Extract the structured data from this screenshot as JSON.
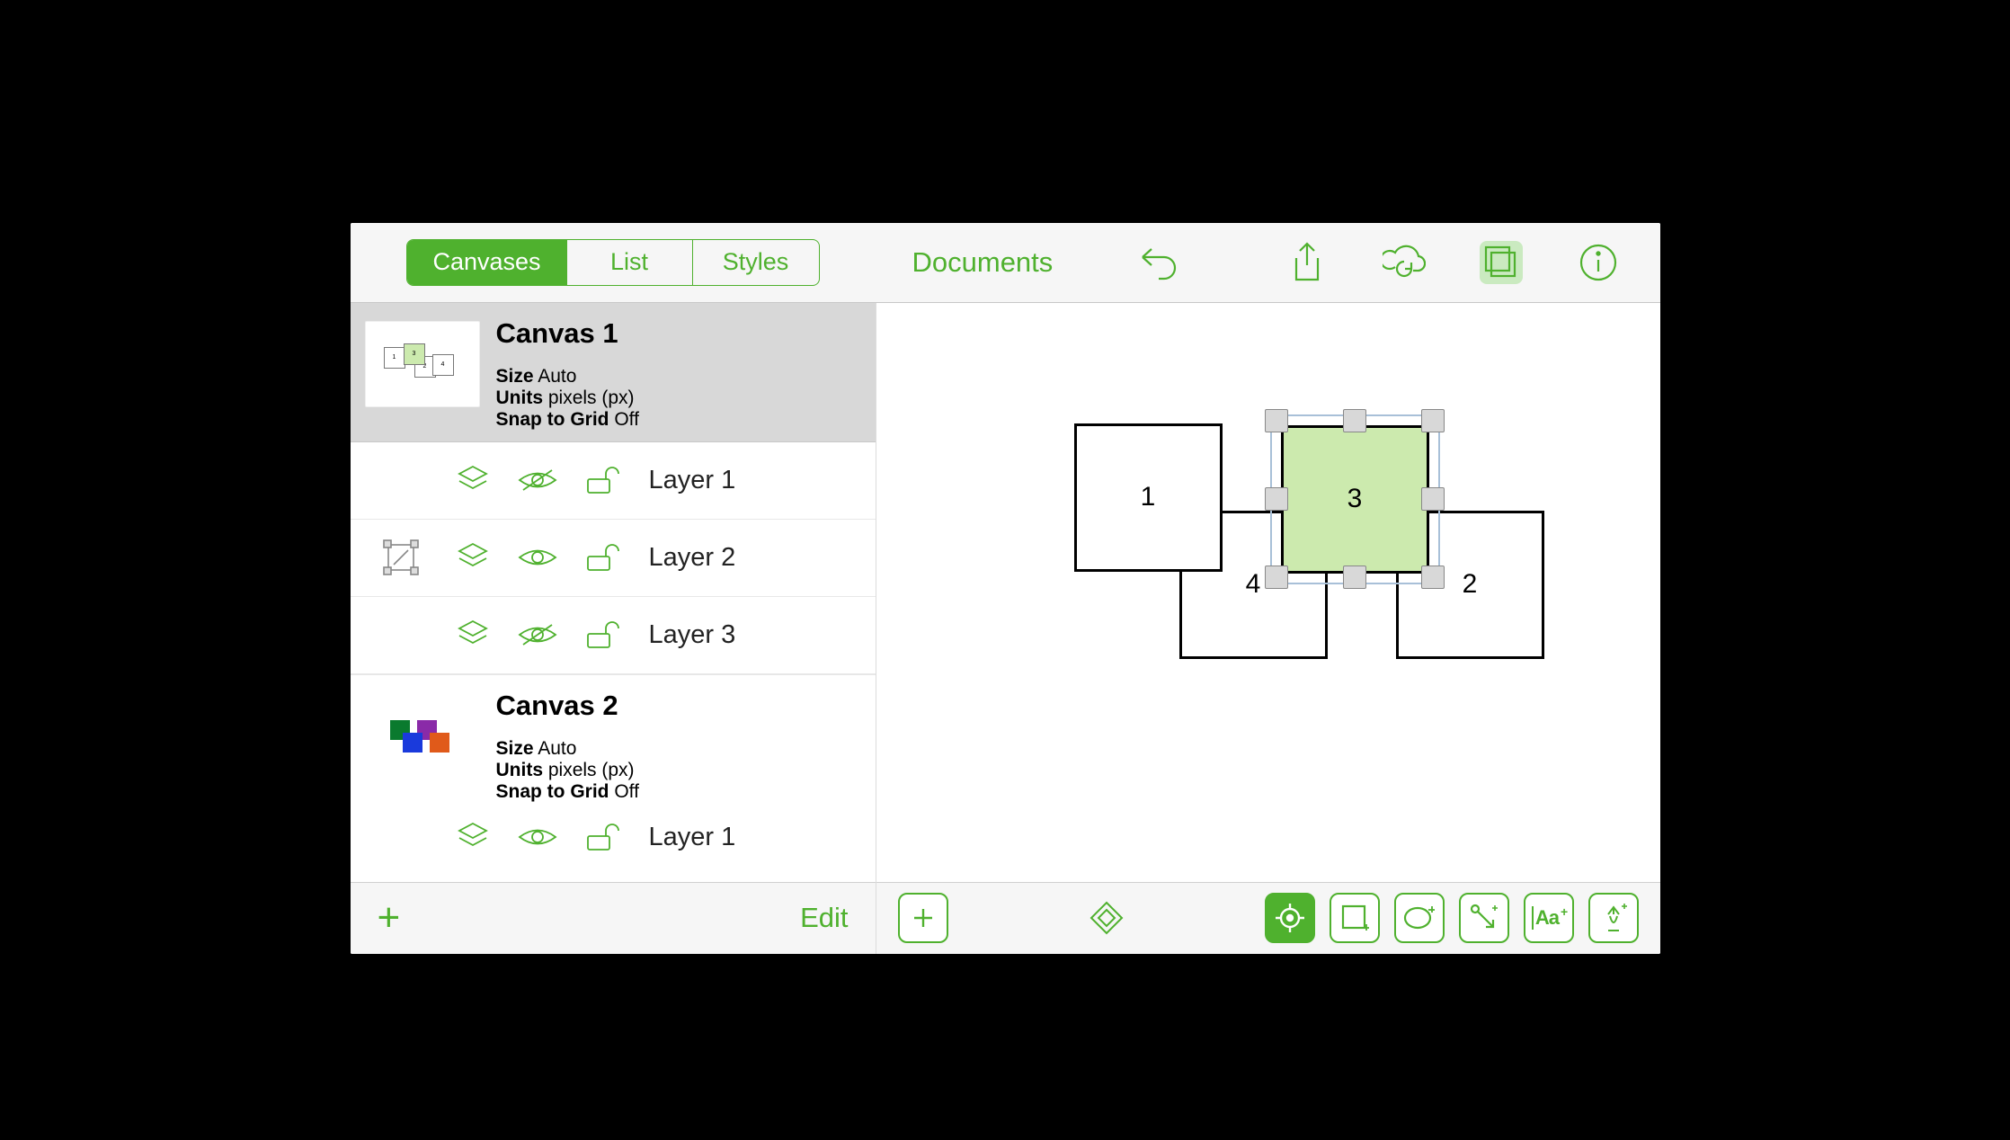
{
  "tabs": {
    "canvases": "Canvases",
    "list": "List",
    "styles": "Styles",
    "active": "canvases"
  },
  "toolbar": {
    "documents": "Documents"
  },
  "canvases": [
    {
      "title": "Canvas 1",
      "selected": true,
      "size_label": "Size",
      "size_value": "Auto",
      "units_label": "Units",
      "units_value": "pixels (px)",
      "snap_label": "Snap to Grid",
      "snap_value": "Off",
      "layers": [
        {
          "name": "Layer 1",
          "visible": false,
          "locked": false,
          "editing": false
        },
        {
          "name": "Layer 2",
          "visible": true,
          "locked": false,
          "editing": true
        },
        {
          "name": "Layer 3",
          "visible": false,
          "locked": false,
          "editing": false
        }
      ]
    },
    {
      "title": "Canvas 2",
      "selected": false,
      "size_label": "Size",
      "size_value": "Auto",
      "units_label": "Units",
      "units_value": "pixels (px)",
      "snap_label": "Snap to Grid",
      "snap_value": "Off",
      "layers": [
        {
          "name": "Layer 1",
          "visible": true,
          "locked": false,
          "editing": false
        }
      ]
    }
  ],
  "sidebar_footer": {
    "edit": "Edit"
  },
  "shapes": {
    "s1": "1",
    "s2": "2",
    "s3": "3",
    "s4": "4"
  },
  "bottom_tools": {
    "text_label": "Aa"
  }
}
